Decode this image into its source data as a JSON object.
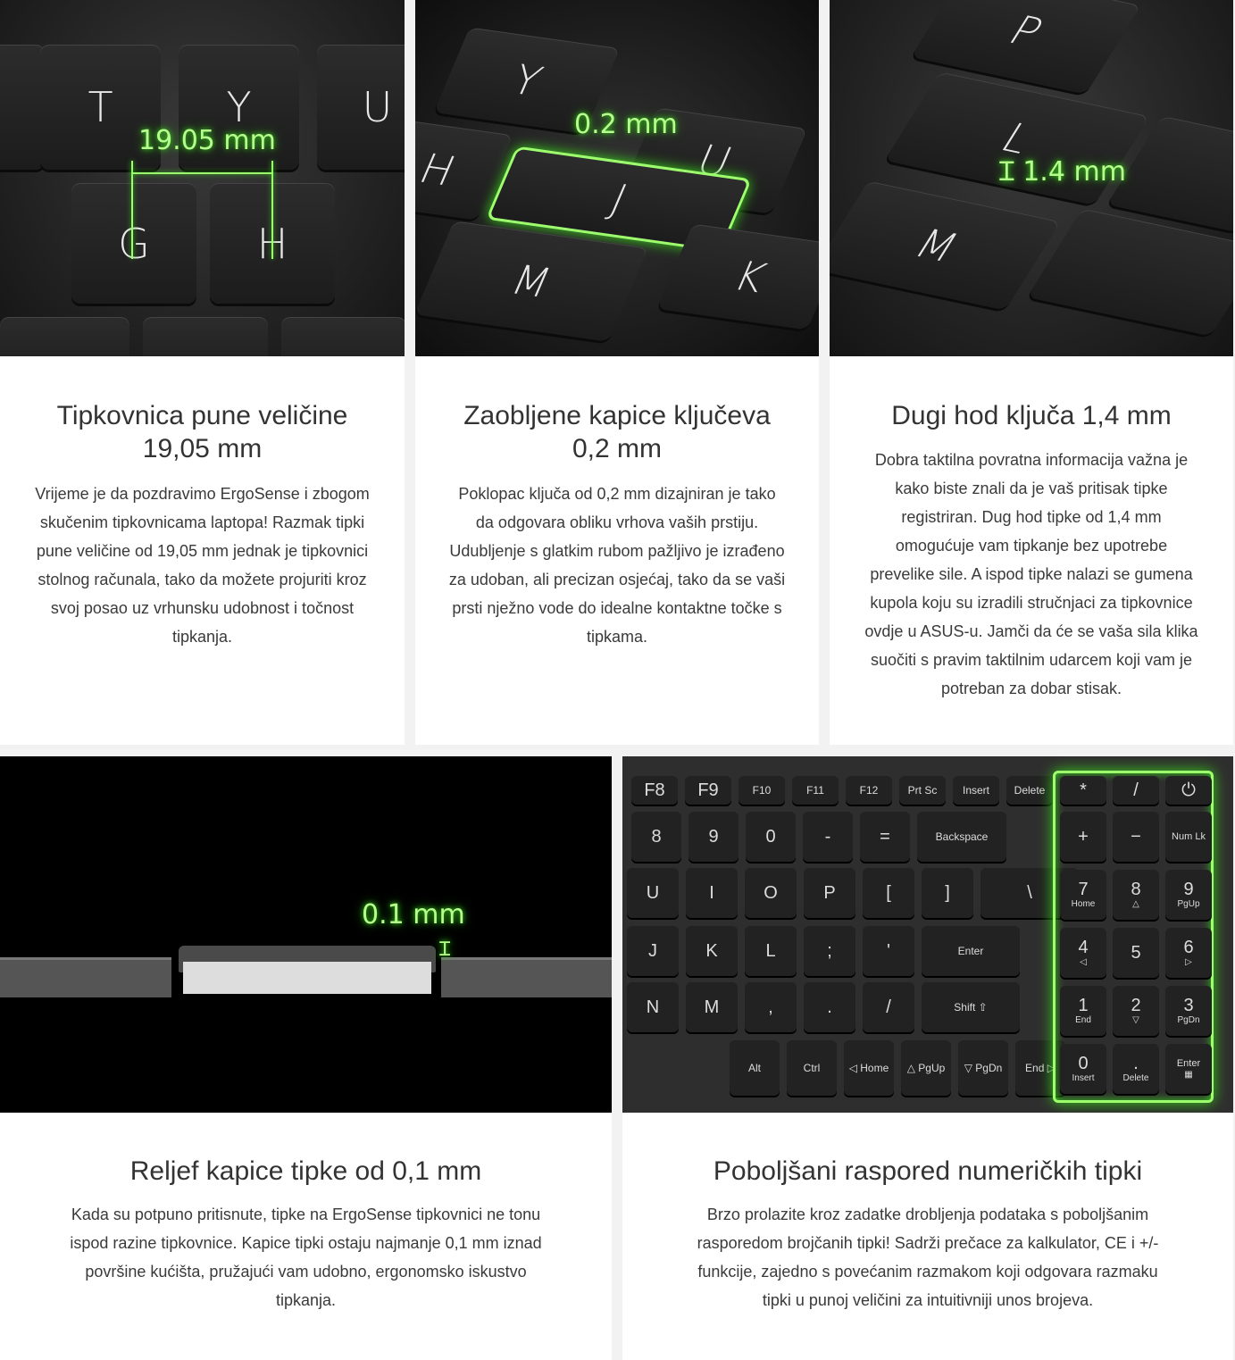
{
  "accent_color": "#9dff6e",
  "cards": [
    {
      "heading_line1": "Tipkovnica pune veličine",
      "heading_line2": "19,05 mm",
      "body": "Vrijeme je da pozdravimo ErgoSense i zbogom skučenim tipkovnicama laptopa! Razmak tipki pune veličine od 19,05 mm jednak je tipkovnici stolnog računala, tako da možete projuriti kroz svoj posao uz vrhunsku udobnost i točnost tipkanja.",
      "image_label": "19.05 mm",
      "keys": [
        "T",
        "Y",
        "U",
        "G",
        "H"
      ]
    },
    {
      "heading_line1": "Zaobljene kapice ključeva",
      "heading_line2": "0,2 mm",
      "body": "Poklopac ključa od 0,2 mm dizajniran je tako da odgovara obliku vrhova vaših prstiju. Udubljenje s glatkim rubom pažljivo je izrađeno za udoban, ali precizan osjećaj, tako da se vaši prsti nježno vode do idealne kontaktne točke s tipkama.",
      "image_label": "0.2 mm",
      "keys": [
        "Y",
        "U",
        "H",
        "J",
        "M",
        "K"
      ]
    },
    {
      "heading_line1": "Dugi hod ključa 1,4 mm",
      "body": "Dobra taktilna povratna informacija važna je kako biste znali da je vaš pritisak tipke registriran. Dug hod tipke od 1,4 mm omogućuje vam tipkanje bez upotrebe prevelike sile. A ispod tipke nalazi se gumena kupola koju su izradili stručnjaci za tipkovnice ovdje u ASUS-u. Jamči da će se vaša sila klika suočiti s pravim taktilnim udarcem koji vam je potreban za dobar stisak.",
      "image_label": "1.4 mm",
      "keys": [
        "P",
        "L",
        "M"
      ]
    },
    {
      "heading_line1": "Reljef kapice tipke od 0,1 mm",
      "body": "Kada su potpuno pritisnute, tipke na ErgoSense tipkovnici ne tonu ispod razine tipkovnice. Kapice tipki ostaju najmanje 0,1 mm iznad površine kućišta, pružajući vam udobno, ergonomsko iskustvo tipkanja.",
      "image_label": "0.1 mm"
    },
    {
      "heading_line1": "Poboljšani raspored numeričkih tipki",
      "body": "Brzo prolazite kroz zadatke drobljenja podataka s poboljšanim rasporedom brojčanih tipki! Sadrži prečace za kalkulator, CE i +/- funkcije, zajedno s povećanim razmakom koji odgovara razmaku tipki u punoj veličini za intuitivniji unos brojeva.",
      "keys": [
        {
          "main": "F8"
        },
        {
          "main": "F9"
        },
        {
          "main": "F10"
        },
        {
          "main": "F11"
        },
        {
          "main": "F12"
        },
        {
          "main": "Prt Sc"
        },
        {
          "main": "Insert"
        },
        {
          "main": "Delete"
        },
        {
          "main": "8"
        },
        {
          "main": "9"
        },
        {
          "main": "0"
        },
        {
          "main": "-"
        },
        {
          "main": "="
        },
        {
          "main": "Backspace"
        },
        {
          "main": "U"
        },
        {
          "main": "I"
        },
        {
          "main": "O"
        },
        {
          "main": "P"
        },
        {
          "main": "["
        },
        {
          "main": "]"
        },
        {
          "main": "\\"
        },
        {
          "main": "J"
        },
        {
          "main": "K"
        },
        {
          "main": "L"
        },
        {
          "main": ";"
        },
        {
          "main": "'"
        },
        {
          "main": "Enter"
        },
        {
          "main": "N"
        },
        {
          "main": "M"
        },
        {
          "main": ","
        },
        {
          "main": "."
        },
        {
          "main": "/"
        },
        {
          "main": "Shift ⇧"
        },
        {
          "main": "Alt"
        },
        {
          "main": "Ctrl"
        },
        {
          "main": "◁ Home"
        },
        {
          "main": "△ PgUp"
        },
        {
          "main": "▽ PgDn"
        },
        {
          "main": "End ▷"
        }
      ],
      "numpad": [
        {
          "main": "*",
          "sub": ""
        },
        {
          "main": "/",
          "sub": ""
        },
        {
          "main": "⏻",
          "sub": ""
        },
        {
          "main": "+",
          "sub": ""
        },
        {
          "main": "−",
          "sub": ""
        },
        {
          "main": "Num Lk",
          "sub": ""
        },
        {
          "main": "7",
          "sub": "Home"
        },
        {
          "main": "8",
          "sub": "△"
        },
        {
          "main": "9",
          "sub": "PgUp"
        },
        {
          "main": "4",
          "sub": "◁"
        },
        {
          "main": "5",
          "sub": ""
        },
        {
          "main": "6",
          "sub": "▷"
        },
        {
          "main": "1",
          "sub": "End"
        },
        {
          "main": "2",
          "sub": "▽"
        },
        {
          "main": "3",
          "sub": "PgDn"
        },
        {
          "main": "0",
          "sub": "Insert"
        },
        {
          "main": ".",
          "sub": "Delete"
        },
        {
          "main": "Enter",
          "sub": "▦"
        }
      ]
    }
  ]
}
